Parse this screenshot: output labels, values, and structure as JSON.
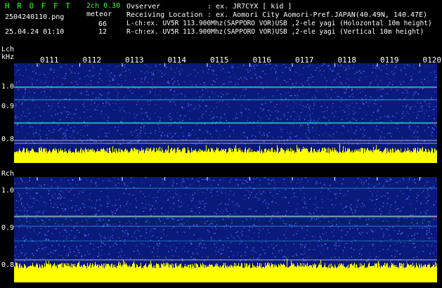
{
  "header": {
    "brand": "H R O F F T",
    "filename": "2504240110.png",
    "datetime": "25.04.24 01:10",
    "mode": "2ch 0.30",
    "meteor_label": "meteor",
    "l_count": "66",
    "r_count": "12",
    "observer_label": "Ovserver",
    "observer_value": ": ex. JR7CYX [ kid ]",
    "location_label": "Receiving Location",
    "location_value": ": ex. Aomori City Aomori-Pref.JAPAN(40.49N, 140.47E)",
    "lch_line": "L-ch:ex. UV5R 113.900Mhz(SAPPORO VOR)USB ,2-ele yagi (Holozontal 10m height)",
    "rch_line": "R-ch:ex. UV5R 113.900Mhz(SAPPORO VOR)USB ,2-ele yagi (Vertical 10m height)"
  },
  "lch": {
    "label": "Lch",
    "unit": "kHz",
    "ticks": [
      "1.0",
      "0.9",
      "0.8"
    ]
  },
  "rch": {
    "label": "Rch",
    "ticks": [
      "1.0",
      "0.9",
      "0.8"
    ]
  },
  "time_marks": [
    "0111",
    "0112",
    "0113",
    "0114",
    "0115",
    "0116",
    "0117",
    "0118",
    "0119",
    "0120"
  ],
  "colors": {
    "brand": "#33ff33",
    "signal": "#ffff00",
    "text": "#ffffff",
    "spectro_bg": "#0a1a7a",
    "line_red": "#ff3030",
    "line_cyan": "#40e0ff"
  }
}
